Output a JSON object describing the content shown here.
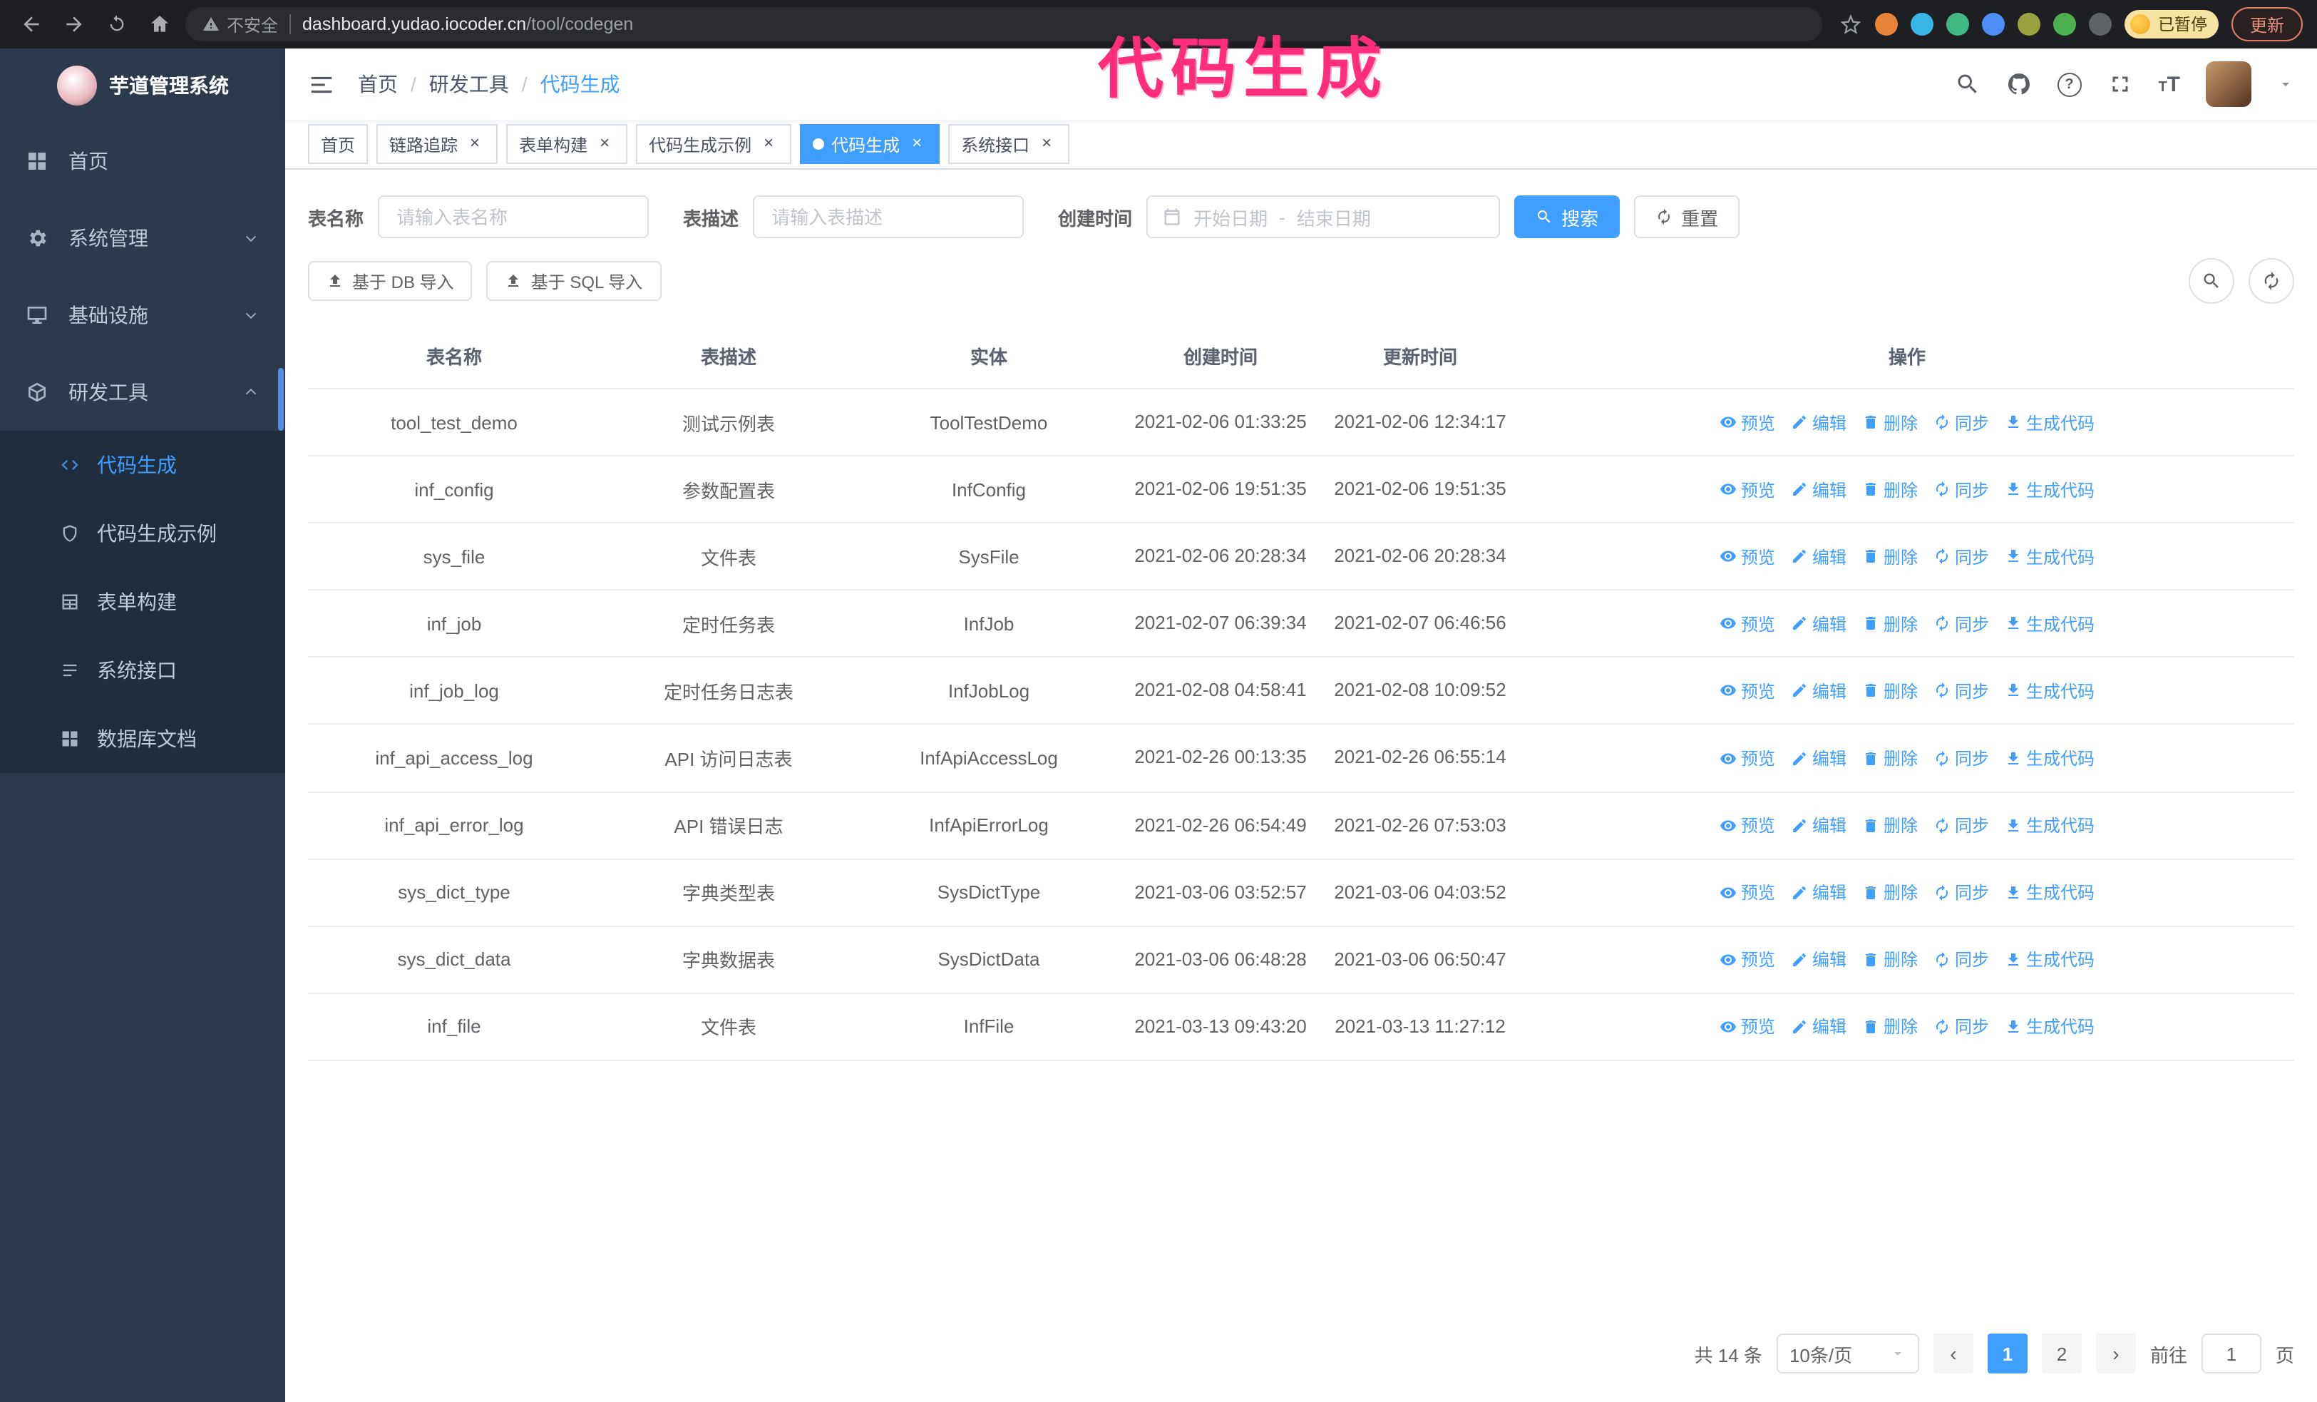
{
  "annotation": {
    "text": "代码生成"
  },
  "browser": {
    "warning_text": "不安全",
    "url_host": "dashboard.yudao.iocoder.cn",
    "url_path": "/tool/codegen",
    "paused_badge": "已暂停",
    "update_button": "更新"
  },
  "sidebar": {
    "logo_title": "芋道管理系统",
    "items": [
      {
        "label": "首页"
      },
      {
        "label": "系统管理"
      },
      {
        "label": "基础设施"
      },
      {
        "label": "研发工具"
      }
    ],
    "submenu": [
      {
        "label": "代码生成",
        "active": true
      },
      {
        "label": "代码生成示例"
      },
      {
        "label": "表单构建"
      },
      {
        "label": "系统接口"
      },
      {
        "label": "数据库文档"
      }
    ]
  },
  "navbar": {
    "breadcrumb": [
      "首页",
      "研发工具",
      "代码生成"
    ]
  },
  "tabs": [
    {
      "label": "首页"
    },
    {
      "label": "链路追踪"
    },
    {
      "label": "表单构建"
    },
    {
      "label": "代码生成示例"
    },
    {
      "label": "代码生成",
      "active": true
    },
    {
      "label": "系统接口"
    }
  ],
  "filters": {
    "table_name_label": "表名称",
    "table_name_placeholder": "请输入表名称",
    "table_desc_label": "表描述",
    "table_desc_placeholder": "请输入表描述",
    "create_time_label": "创建时间",
    "date_start_placeholder": "开始日期",
    "date_separator": "-",
    "date_end_placeholder": "结束日期",
    "search_button": "搜索",
    "reset_button": "重置"
  },
  "toolbar": {
    "import_db_button": "基于 DB 导入",
    "import_sql_button": "基于 SQL 导入"
  },
  "icons": {
    "nav_right": [
      "search",
      "github",
      "question",
      "fullscreen",
      "font-size",
      "avatar",
      "caret-down"
    ],
    "row_actions": [
      "eye",
      "edit",
      "trash",
      "sync",
      "download"
    ]
  },
  "table": {
    "columns": [
      "表名称",
      "表描述",
      "实体",
      "创建时间",
      "更新时间",
      "操作"
    ],
    "actions": [
      "预览",
      "编辑",
      "删除",
      "同步",
      "生成代码"
    ],
    "rows": [
      {
        "name": "tool_test_demo",
        "desc": "测试示例表",
        "entity": "ToolTestDemo",
        "created": "2021-02-06 01:33:25",
        "updated": "2021-02-06 12:34:17"
      },
      {
        "name": "inf_config",
        "desc": "参数配置表",
        "entity": "InfConfig",
        "created": "2021-02-06 19:51:35",
        "updated": "2021-02-06 19:51:35"
      },
      {
        "name": "sys_file",
        "desc": "文件表",
        "entity": "SysFile",
        "created": "2021-02-06 20:28:34",
        "updated": "2021-02-06 20:28:34"
      },
      {
        "name": "inf_job",
        "desc": "定时任务表",
        "entity": "InfJob",
        "created": "2021-02-07 06:39:34",
        "updated": "2021-02-07 06:46:56"
      },
      {
        "name": "inf_job_log",
        "desc": "定时任务日志表",
        "entity": "InfJobLog",
        "created": "2021-02-08 04:58:41",
        "updated": "2021-02-08 10:09:52"
      },
      {
        "name": "inf_api_access_log",
        "desc": "API 访问日志表",
        "entity": "InfApiAccessLog",
        "created": "2021-02-26 00:13:35",
        "updated": "2021-02-26 06:55:14"
      },
      {
        "name": "inf_api_error_log",
        "desc": "API 错误日志",
        "entity": "InfApiErrorLog",
        "created": "2021-02-26 06:54:49",
        "updated": "2021-02-26 07:53:03"
      },
      {
        "name": "sys_dict_type",
        "desc": "字典类型表",
        "entity": "SysDictType",
        "created": "2021-03-06 03:52:57",
        "updated": "2021-03-06 04:03:52"
      },
      {
        "name": "sys_dict_data",
        "desc": "字典数据表",
        "entity": "SysDictData",
        "created": "2021-03-06 06:48:28",
        "updated": "2021-03-06 06:50:47"
      },
      {
        "name": "inf_file",
        "desc": "文件表",
        "entity": "InfFile",
        "created": "2021-03-13 09:43:20",
        "updated": "2021-03-13 11:27:12"
      }
    ]
  },
  "pagination": {
    "total": "共 14 条",
    "page_size": "10条/页",
    "pages": [
      "1",
      "2"
    ],
    "active_page": "1",
    "goto_label": "前往",
    "goto_value": "1",
    "goto_unit": "页"
  }
}
